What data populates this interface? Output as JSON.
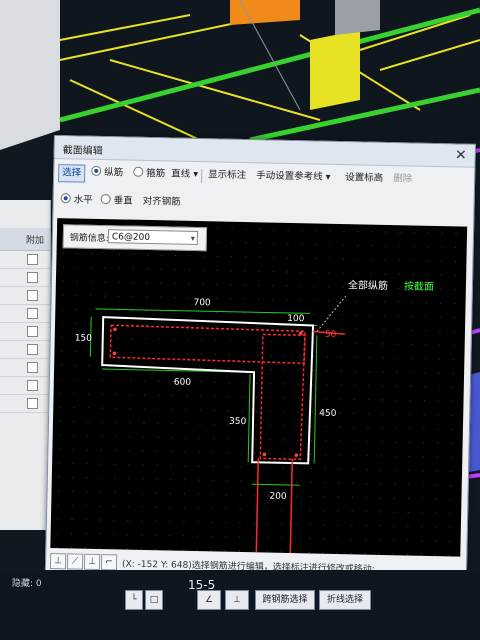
{
  "dialog": {
    "title": "截面编辑",
    "close_icon": "close-icon",
    "toolbar_row1": {
      "select": "选择",
      "longitudinal": "纵筋",
      "stirrup": "箍筋",
      "straight": "直线",
      "show_annotation": "显示标注",
      "manual_ref": "手动设置参考线",
      "set_elevation": "设置标高",
      "delete": "删除"
    },
    "toolbar_row2": {
      "horizontal": "水平",
      "vertical": "垂直",
      "align_rebar": "对齐钢筋"
    },
    "rebar_info": {
      "label": "钢筋信息:",
      "value": "C6@200"
    },
    "drawing": {
      "all_longitudinal": "全部纵筋",
      "press_shift": "按截面",
      "dims": {
        "d700": "700",
        "d100": "100",
        "d150": "150",
        "d50": "50",
        "d600": "600",
        "d350": "350",
        "d450": "450",
        "d200": "200"
      }
    },
    "status": {
      "coords_hint": "(X: -152 Y: 648)选择钢筋进行编辑，选择标注进行修改或移动;"
    }
  },
  "side_panel": {
    "header": "附加"
  },
  "bottom": {
    "left_text": "隐藏: 0",
    "section_label": "15-5",
    "buttons": [
      "跨钢筋选择",
      "折线选择"
    ]
  },
  "colors": {
    "accent": "#2c6fd1",
    "outline": "#ffffff",
    "rebar": "#ff2a2a",
    "dim": "#22cc22",
    "highlight_text": "#3cff3c"
  }
}
